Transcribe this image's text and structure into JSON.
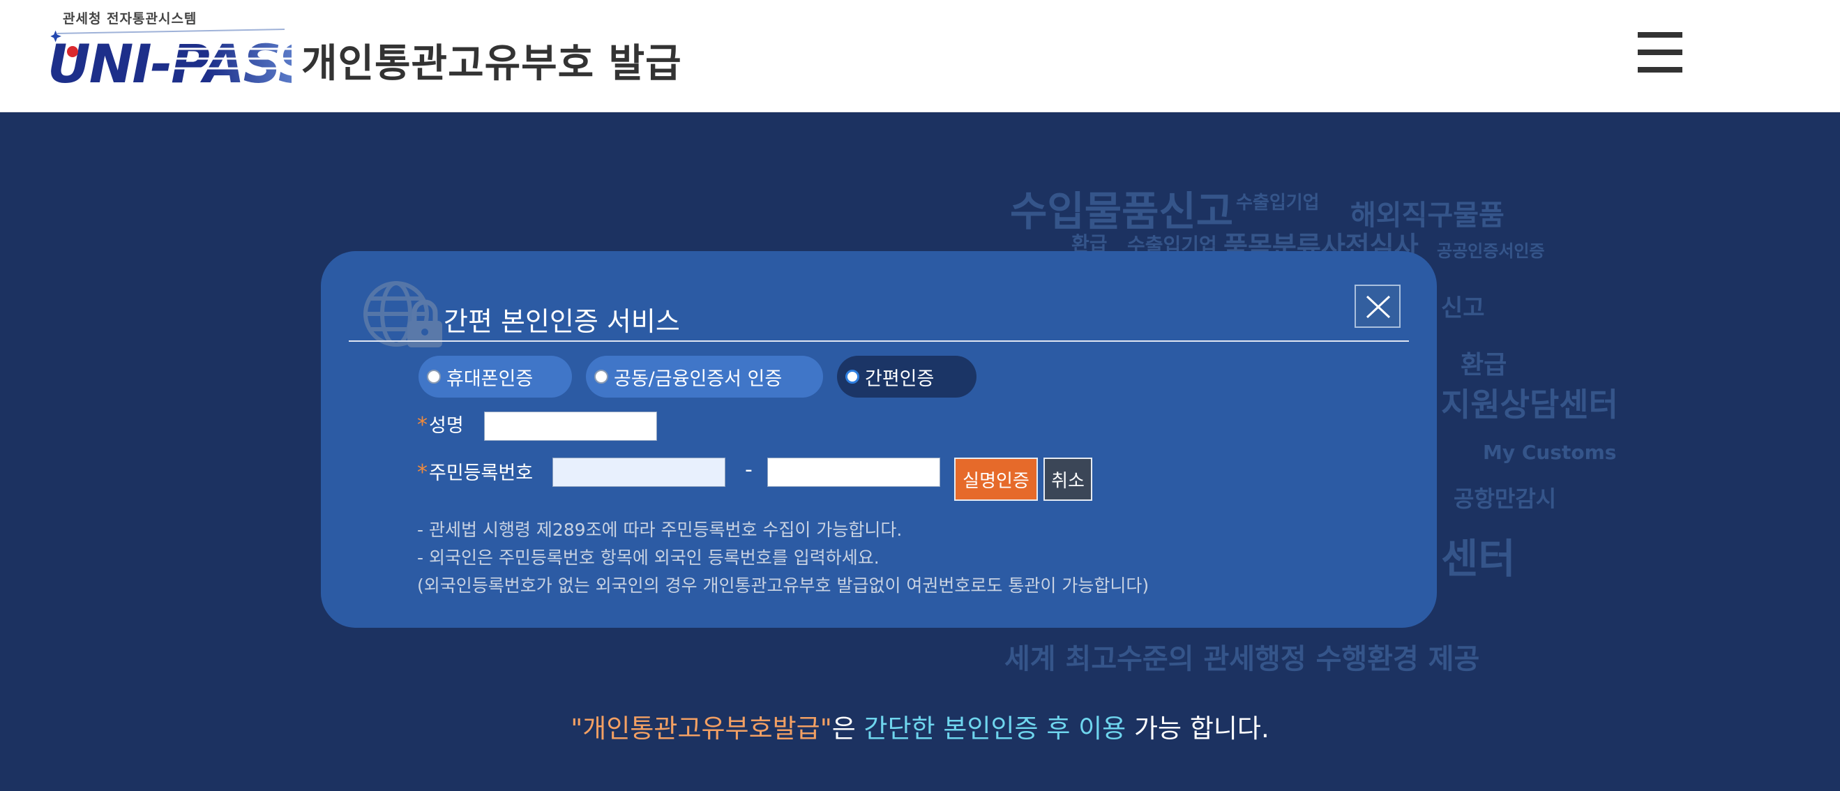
{
  "header": {
    "system_label": "관세청 전자통관시스템",
    "logo_text": "UNI-PASS",
    "page_heading": "개인통관고유부호  발급"
  },
  "background_cloud": [
    {
      "text": "수입물품신고",
      "size": 58
    },
    {
      "text": "수출입기업",
      "size": 26
    },
    {
      "text": "해외직구물품",
      "size": 40
    },
    {
      "text": "환급",
      "size": 28
    },
    {
      "text": "수출입기업",
      "size": 28
    },
    {
      "text": "품목분류사전심사",
      "size": 38
    },
    {
      "text": "공공인증서인증",
      "size": 24
    },
    {
      "text": "신고",
      "size": 34
    },
    {
      "text": "환급",
      "size": 36
    },
    {
      "text": "지원상담센터",
      "size": 46
    },
    {
      "text": "My Customs",
      "size": 28
    },
    {
      "text": "공항만감시",
      "size": 32
    },
    {
      "text": "센터",
      "size": 58
    },
    {
      "text": "세계 최고수준의 관세행정 수행환경 제공",
      "size": 40
    }
  ],
  "modal": {
    "title": "간편 본인인증 서비스",
    "close_label": "X",
    "auth_options": [
      {
        "label": "휴대폰인증",
        "selected": false
      },
      {
        "label": "공동/금융인증서 인증",
        "selected": false
      },
      {
        "label": "간편인증",
        "selected": true
      }
    ],
    "name_label": "성명",
    "name_value": "",
    "rrn_label": "주민등록번호",
    "rrn_first_value": "",
    "rrn_separator": "-",
    "rrn_second_value": "",
    "verify_button": "실명인증",
    "cancel_button": "취소",
    "required_mark": "*",
    "notes": [
      "- 관세법 시행령 제289조에 따라 주민등록번호 수집이 가능합니다.",
      "- 외국인은 주민등록번호 항목에 외국인 등록번호를 입력하세요.",
      "(외국인등록번호가 없는 외국인의 경우 개인통관고유부호 발급없이 여권번호로도 통관이 가능합니다)"
    ]
  },
  "tagline": {
    "part1": "\"개인통관고유부호발급\"",
    "part2": "은 ",
    "part3": "간단한 본인인증 후 이용",
    "part4": " 가능 합니다."
  },
  "colors": {
    "page_background": "#1c3261",
    "modal_background": "#2c5ba4",
    "pill": "#4076c8",
    "pill_selected": "#1b3566",
    "verify_button": "#e66a2a",
    "cancel_button": "#3b4657",
    "accent_orange": "#f3a063",
    "accent_cyan": "#6fd6ee"
  },
  "icons": {
    "menu": "hamburger-menu-icon",
    "close": "close-icon",
    "modal": "globe-lock-icon"
  }
}
